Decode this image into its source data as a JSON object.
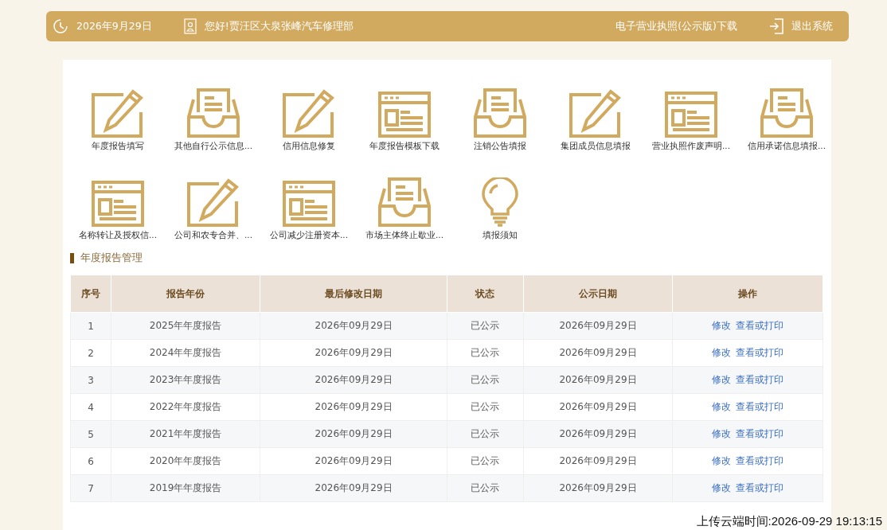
{
  "header": {
    "date": "2026年9月29日",
    "greeting": "您好!贾汪区大泉张峰汽车修理部",
    "license_link": "电子营业执照(公示版)下载",
    "logout": "退出系统"
  },
  "shortcuts": [
    {
      "kind": "edit",
      "label": "年度报告填写"
    },
    {
      "kind": "inbox",
      "label": "其他自行公示信息..."
    },
    {
      "kind": "edit",
      "label": "信用信息修复"
    },
    {
      "kind": "window",
      "label": "年度报告模板下载"
    },
    {
      "kind": "inbox",
      "label": "注销公告填报"
    },
    {
      "kind": "edit",
      "label": "集团成员信息填报"
    },
    {
      "kind": "window",
      "label": "营业执照作废声明..."
    },
    {
      "kind": "inbox",
      "label": "信用承诺信息填报..."
    },
    {
      "kind": "window",
      "label": "名称转让及授权信..."
    },
    {
      "kind": "edit",
      "label": "公司和农专合并、..."
    },
    {
      "kind": "window",
      "label": "公司减少注册资本..."
    },
    {
      "kind": "inbox",
      "label": "市场主体终止歇业..."
    },
    {
      "kind": "bulb",
      "label": "填报须知"
    }
  ],
  "section_title": "年度报告管理",
  "table": {
    "columns": [
      "序号",
      "报告年份",
      "最后修改日期",
      "状态",
      "公示日期",
      "操作"
    ],
    "rows": [
      {
        "index": "1",
        "year": "2025年年度报告",
        "modified": "2026年09月29日",
        "status": "已公示",
        "published": "2026年09月29日",
        "actions": [
          "修改",
          "查看或打印"
        ]
      },
      {
        "index": "2",
        "year": "2024年年度报告",
        "modified": "2026年09月29日",
        "status": "已公示",
        "published": "2026年09月29日",
        "actions": [
          "修改",
          "查看或打印"
        ]
      },
      {
        "index": "3",
        "year": "2023年年度报告",
        "modified": "2026年09月29日",
        "status": "已公示",
        "published": "2026年09月29日",
        "actions": [
          "修改",
          "查看或打印"
        ]
      },
      {
        "index": "4",
        "year": "2022年年度报告",
        "modified": "2026年09月29日",
        "status": "已公示",
        "published": "2026年09月29日",
        "actions": [
          "修改",
          "查看或打印"
        ]
      },
      {
        "index": "5",
        "year": "2021年年度报告",
        "modified": "2026年09月29日",
        "status": "已公示",
        "published": "2026年09月29日",
        "actions": [
          "修改",
          "查看或打印"
        ]
      },
      {
        "index": "6",
        "year": "2020年年度报告",
        "modified": "2026年09月29日",
        "status": "已公示",
        "published": "2026年09月29日",
        "actions": [
          "修改",
          "查看或打印"
        ]
      },
      {
        "index": "7",
        "year": "2019年年度报告",
        "modified": "2026年09月29日",
        "status": "已公示",
        "published": "2026年09月29日",
        "actions": [
          "修改",
          "查看或打印"
        ]
      }
    ]
  },
  "upload_stamp": "上传云端时间:2026-09-29 19:13:15"
}
